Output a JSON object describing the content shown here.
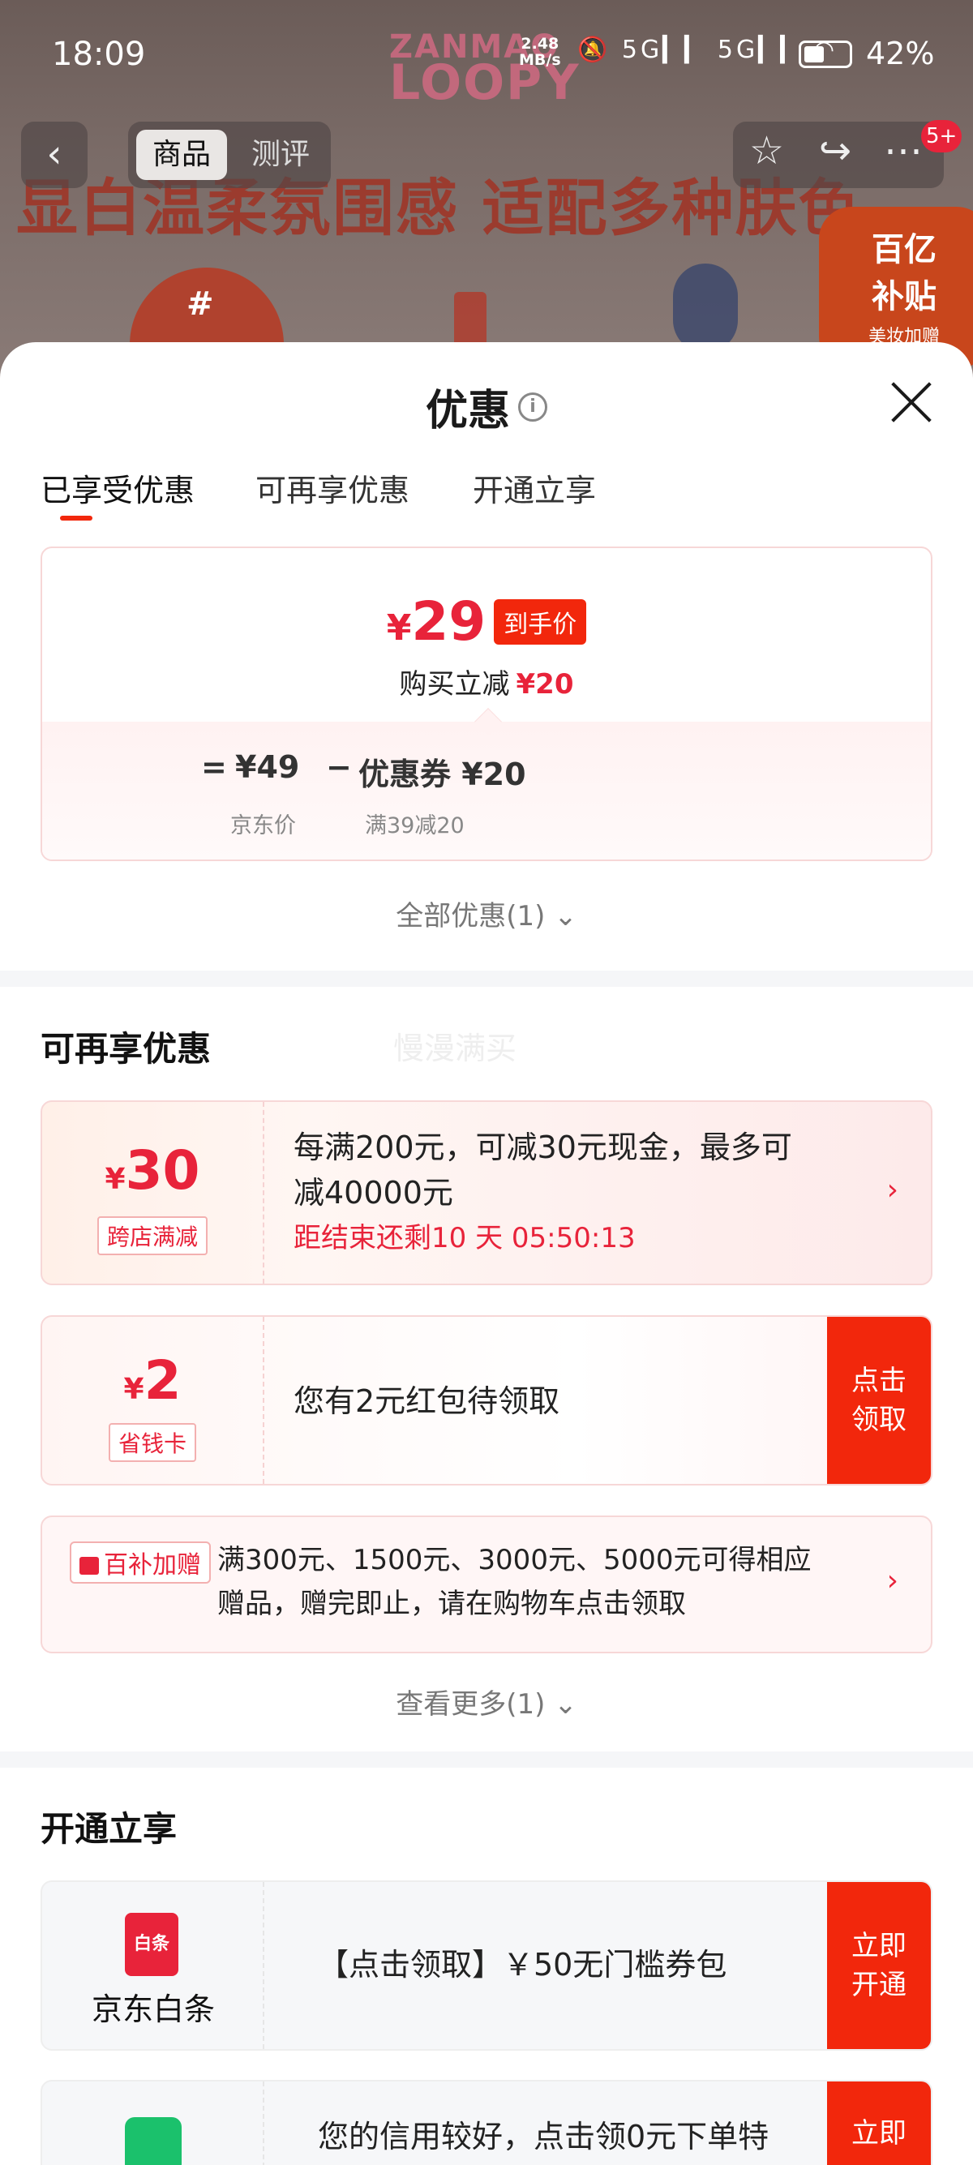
{
  "status_bar": {
    "time": "18:09",
    "net_speed_value": "2.48",
    "net_speed_unit": "MB/s",
    "signal_icons": "5G▎▎ 5G▎▎",
    "battery": "42%"
  },
  "product_header": {
    "brand_line1": "ZANMAO",
    "brand_line2": "LOOPY",
    "slogan": "显白温柔氛围感 适配多种肤色",
    "sticker_text": "#",
    "promo_badge": {
      "line1": "百亿",
      "line2": "补贴",
      "line3": "美妆加赠"
    },
    "nav_tabs": [
      "商品",
      "测评"
    ],
    "notification_count": "5+"
  },
  "sheet": {
    "title": "优惠",
    "tabs": [
      "已享受优惠",
      "可再享优惠",
      "开通立享"
    ]
  },
  "enjoyed": {
    "currency": "¥",
    "final_price": "29",
    "price_tag": "到手价",
    "reduce_label": "购买立减",
    "reduce_amount": "¥20",
    "equals": "=",
    "jd_price": "¥49",
    "minus": "−",
    "coupon": "优惠券 ¥20",
    "jd_price_label": "京东价",
    "coupon_rule": "满39减20",
    "all_discounts": "全部优惠(1) ⌄"
  },
  "more_offers": {
    "title": "可再享优惠",
    "watermark": "慢漫满买",
    "cross_store": {
      "amount": "30",
      "badge": "跨店满减",
      "desc_line1": "每满200元，可减30元现金，最多可",
      "desc_line2": "减40000元",
      "countdown": "距结束还剩10 天 05:50:13"
    },
    "saver_card": {
      "amount": "2",
      "badge": "省钱卡",
      "desc": "您有2元红包待领取",
      "cta_line1": "点击",
      "cta_line2": "领取"
    },
    "gift": {
      "tag": "百补加赠",
      "desc_line1": "满300元、1500元、3000元、5000元可得相应",
      "desc_line2": "赠品，赠完即止，请在购物车点击领取"
    },
    "view_more": "查看更多(1) ⌄"
  },
  "open_now": {
    "title": "开通立享",
    "baitiao": {
      "icon_text": "白条",
      "label": "京东白条",
      "desc": "【点击领取】￥50无门槛券包",
      "cta_line1": "立即",
      "cta_line2": "开通"
    },
    "credit": {
      "desc": "您的信用较好，点击领0元下单特",
      "cta_line1": "立即"
    }
  },
  "colors": {
    "accent": "#f2270c",
    "price_red": "#e8233a"
  }
}
